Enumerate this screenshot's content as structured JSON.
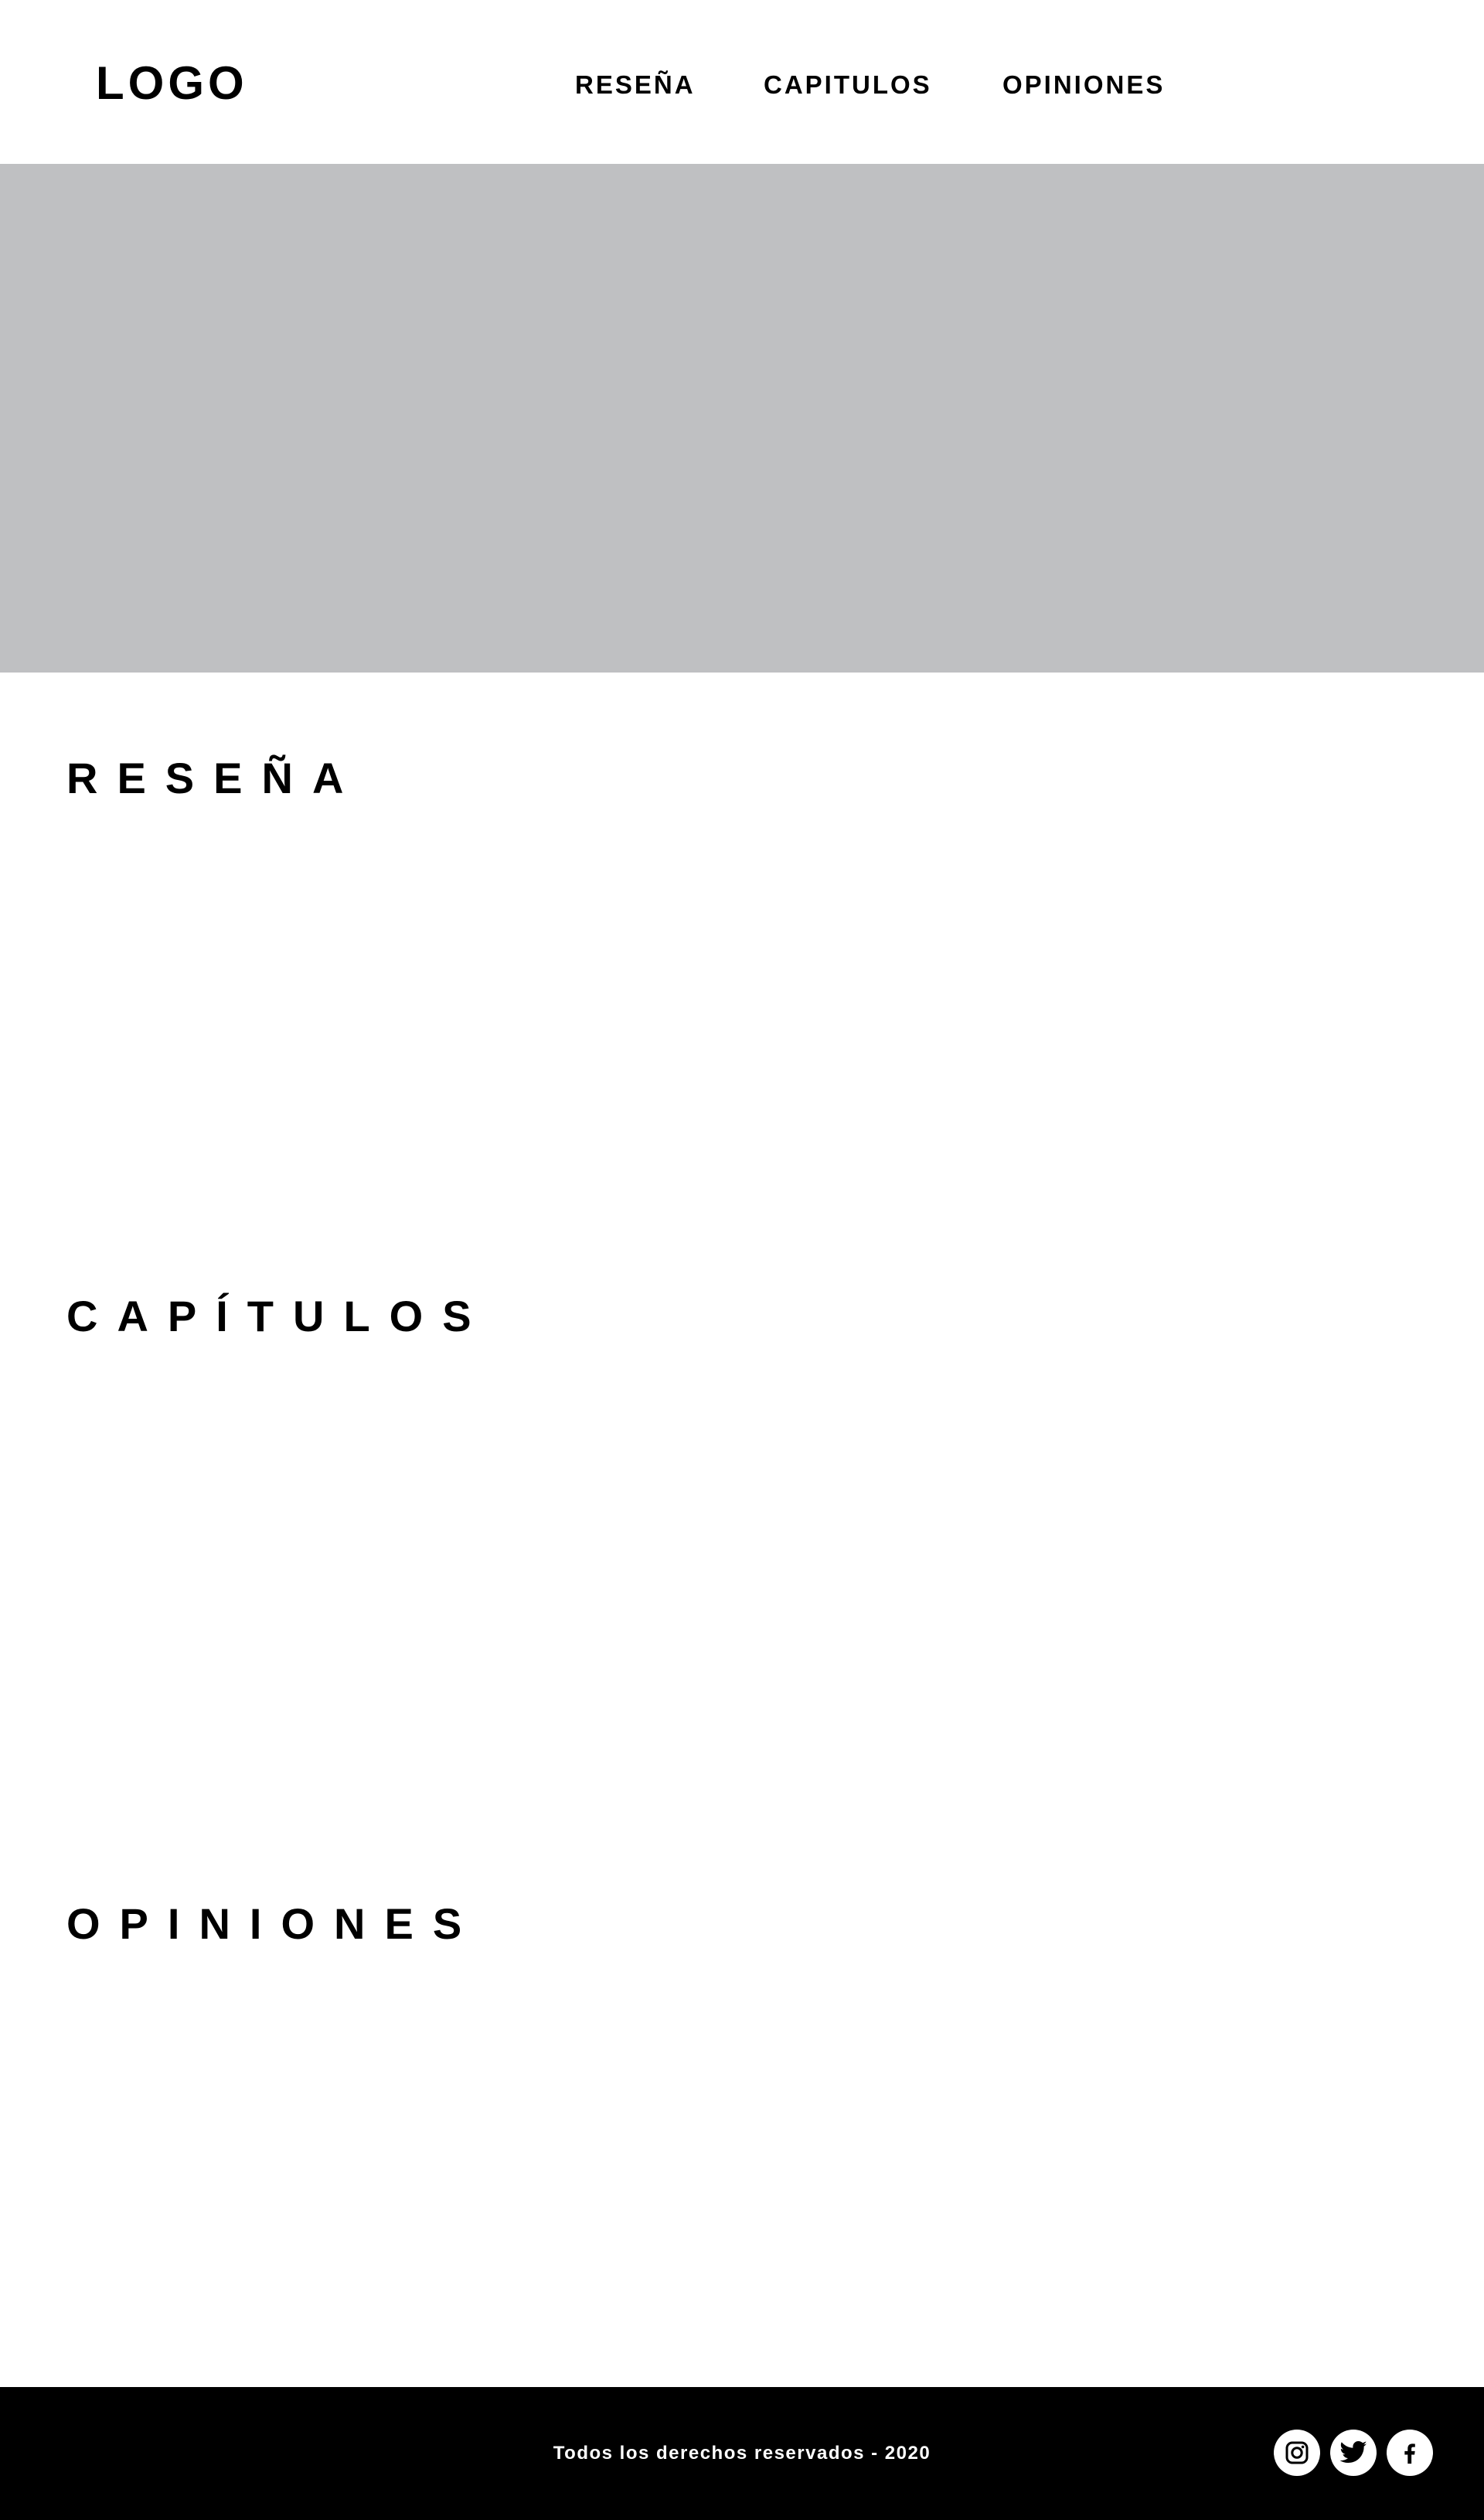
{
  "header": {
    "logo": "LOGO",
    "nav": [
      {
        "label": "RESEÑA"
      },
      {
        "label": "CAPITULOS"
      },
      {
        "label": "OPINIONES"
      }
    ]
  },
  "hero": {
    "background": "#bfc0c2"
  },
  "sections": [
    {
      "title": "RESEÑA"
    },
    {
      "title": "CAPÍTULOS"
    },
    {
      "title": "OPINIONES"
    }
  ],
  "footer": {
    "copyright": "Todos los derechos reservados - 2020",
    "background": "#000000",
    "social": [
      {
        "icon": "instagram-icon"
      },
      {
        "icon": "twitter-icon"
      },
      {
        "icon": "facebook-icon"
      }
    ]
  }
}
